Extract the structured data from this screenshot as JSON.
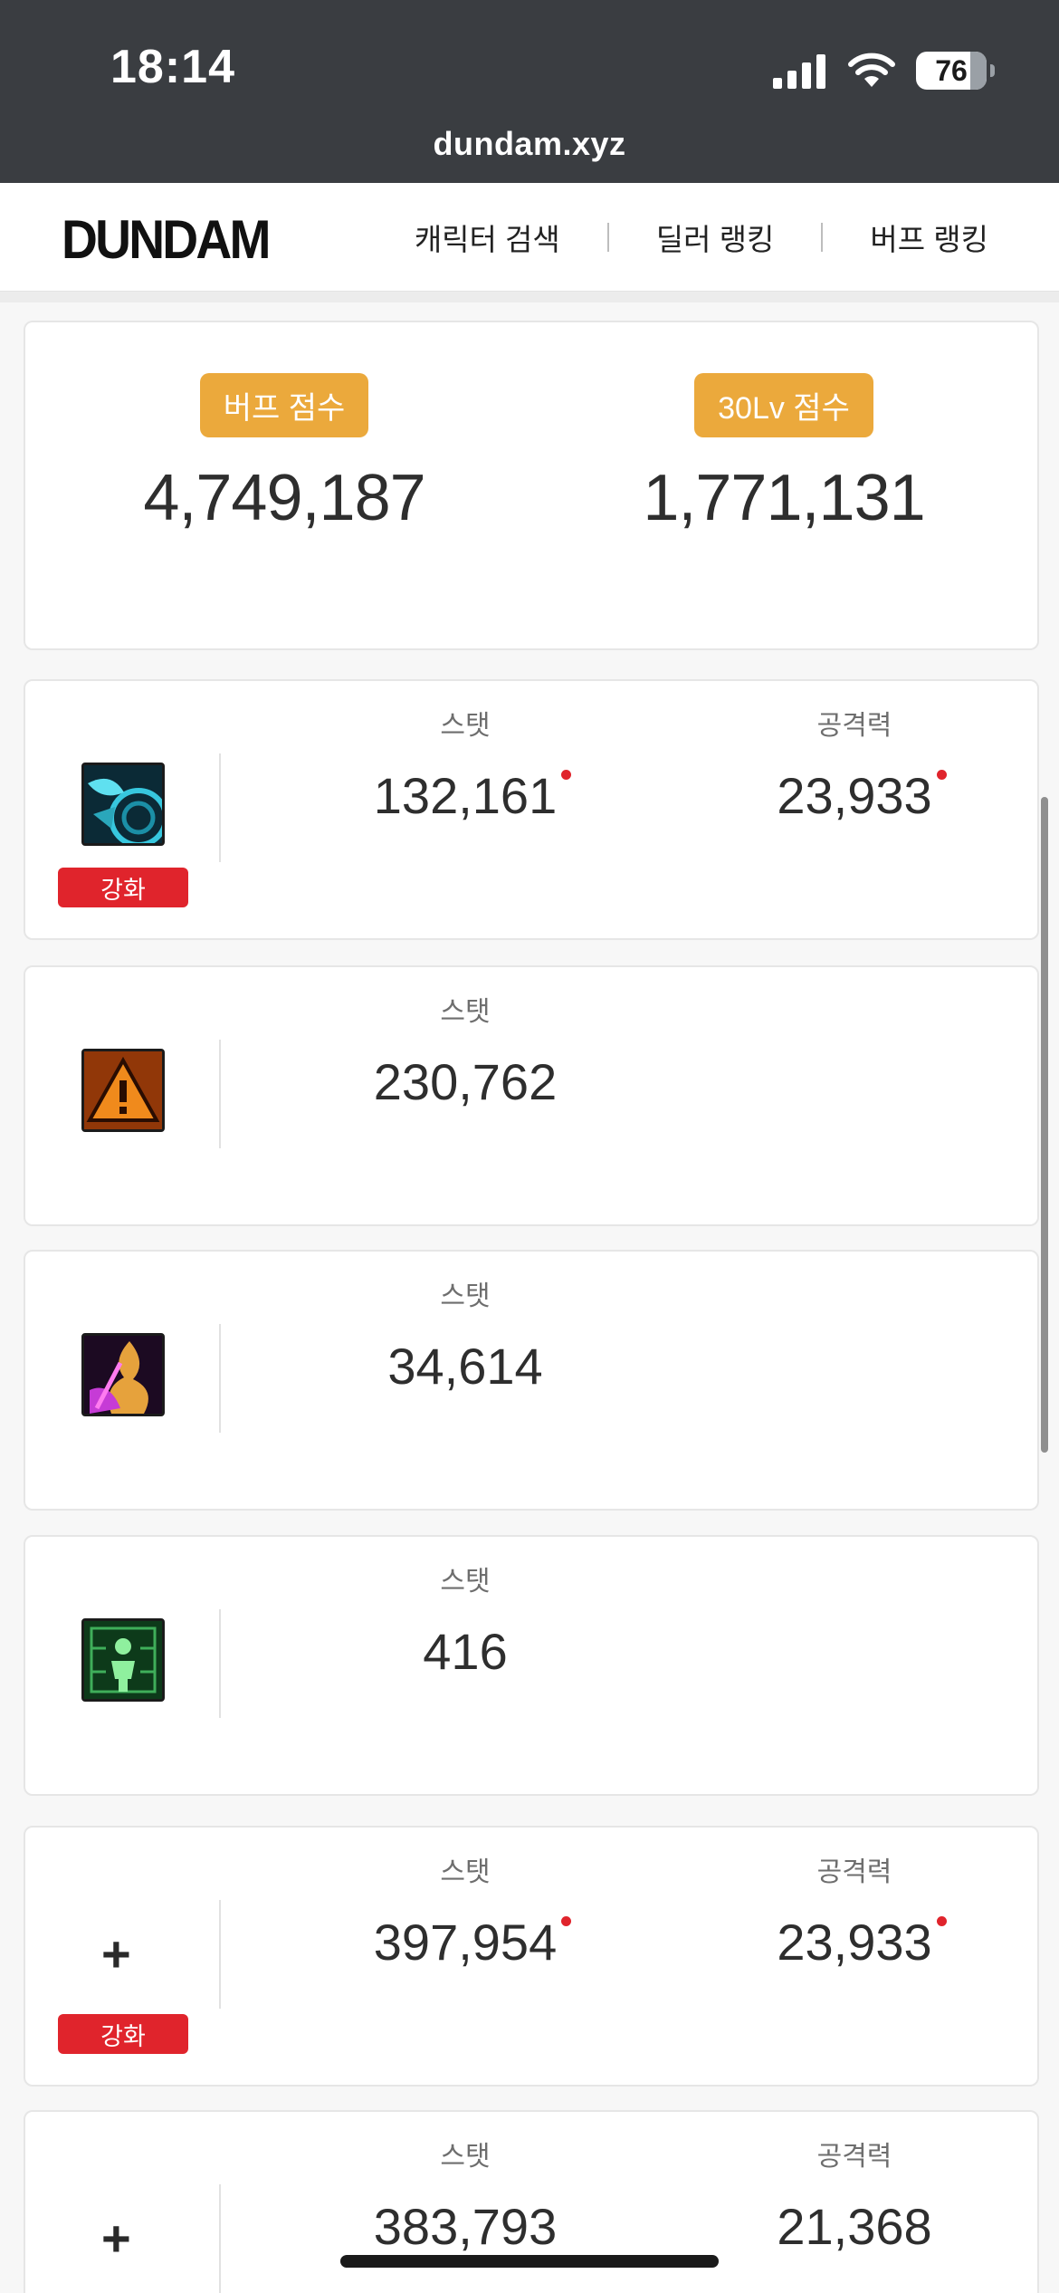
{
  "status_bar": {
    "time": "18:14",
    "battery": "76"
  },
  "browser": {
    "url": "dundam.xyz"
  },
  "header": {
    "logo": "DUNDAM",
    "nav": [
      "캐릭터 검색",
      "딜러 랭킹",
      "버프 랭킹"
    ]
  },
  "scores": [
    {
      "label": "버프 점수",
      "value": "4,749,187"
    },
    {
      "label": "30Lv 점수",
      "value": "1,771,131"
    }
  ],
  "skills": [
    {
      "icon": "cyan-tech-skill-icon",
      "enhance": "강화",
      "stat_label": "스탯",
      "stat": "132,161",
      "stat_dot": true,
      "atk_label": "공격력",
      "atk": "23,933",
      "atk_dot": true
    },
    {
      "icon": "warning-skill-icon",
      "enhance": "",
      "stat_label": "스탯",
      "stat": "230,762",
      "stat_dot": false,
      "atk_label": "",
      "atk": "",
      "atk_dot": false
    },
    {
      "icon": "purple-flame-skill-icon",
      "enhance": "",
      "stat_label": "스탯",
      "stat": "34,614",
      "stat_dot": false,
      "atk_label": "",
      "atk": "",
      "atk_dot": false
    },
    {
      "icon": "green-figure-skill-icon",
      "enhance": "",
      "stat_label": "스탯",
      "stat": "416",
      "stat_dot": false,
      "atk_label": "",
      "atk": "",
      "atk_dot": false
    },
    {
      "icon": "plus-icon",
      "enhance": "강화",
      "stat_label": "스탯",
      "stat": "397,954",
      "stat_dot": true,
      "atk_label": "공격력",
      "atk": "23,933",
      "atk_dot": true
    },
    {
      "icon": "plus-icon",
      "enhance": "",
      "stat_label": "스탯",
      "stat": "383,793",
      "stat_dot": false,
      "atk_label": "공격력",
      "atk": "21,368",
      "atk_dot": false
    }
  ],
  "plus_glyph": "+",
  "colors": {
    "badge": "#eba93c",
    "enhance": "#e0242c",
    "status_bar": "#3a3d41"
  }
}
